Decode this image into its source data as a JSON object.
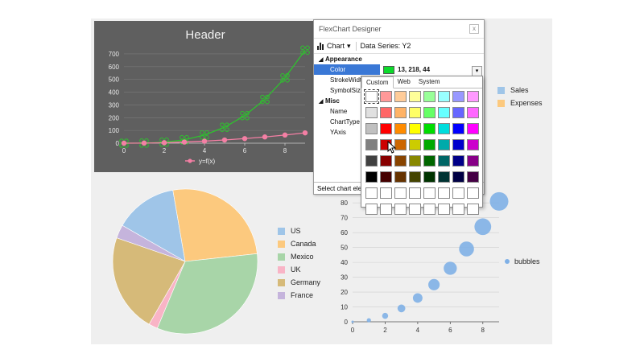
{
  "colors": {
    "bg": "#efefef",
    "line_panel": "#5f5f5f",
    "green": "#2ec22e",
    "pink": "#f47fa4",
    "selected": "#3a78d6"
  },
  "chart_data": [
    {
      "type": "line",
      "title": "Header",
      "x": [
        0,
        1,
        2,
        3,
        4,
        5,
        6,
        7,
        8,
        9
      ],
      "series": [
        {
          "name": "",
          "color": "#2ec22e",
          "values": [
            0,
            1,
            8,
            27,
            64,
            125,
            216,
            343,
            512,
            729
          ]
        },
        {
          "name": "y=f(x)",
          "color": "#f47fa4",
          "values": [
            0,
            1,
            4,
            9,
            16,
            25,
            36,
            49,
            64,
            81
          ]
        }
      ],
      "xticks": [
        "0",
        "2",
        "4",
        "6",
        "8"
      ],
      "yticks": [
        "0",
        "100",
        "200",
        "300",
        "400",
        "500",
        "600",
        "700"
      ],
      "xlim": [
        0,
        9
      ],
      "ylim": [
        0,
        750
      ],
      "legend": [
        "y=f(x)"
      ]
    },
    {
      "type": "pie",
      "slices": [
        {
          "name": "US",
          "value": 14,
          "color": "#9fc5e8"
        },
        {
          "name": "Canada",
          "value": 26,
          "color": "#fcc97e"
        },
        {
          "name": "Mexico",
          "value": 33,
          "color": "#a8d5a8"
        },
        {
          "name": "UK",
          "value": 2,
          "color": "#f9b4c6"
        },
        {
          "name": "Germany",
          "value": 22,
          "color": "#d6ba79"
        },
        {
          "name": "France",
          "value": 3,
          "color": "#c5b4dc"
        }
      ]
    },
    {
      "type": "scatter",
      "series": [
        {
          "name": "bubbles",
          "color": "#7fb0e6"
        }
      ],
      "x": [
        0,
        1,
        2,
        3,
        4,
        5,
        6,
        7,
        8,
        9
      ],
      "y": [
        0,
        1,
        4,
        9,
        16,
        25,
        36,
        49,
        64,
        81
      ],
      "xticks": [
        "0",
        "2",
        "4",
        "6",
        "8"
      ],
      "yticks": [
        "0",
        "10",
        "20",
        "30",
        "40",
        "50",
        "60",
        "70",
        "80"
      ],
      "xlim": [
        0,
        9
      ],
      "ylim": [
        0,
        85
      ]
    }
  ],
  "top_legend": {
    "items": [
      {
        "label": "Sales",
        "color": "#9fc5e8"
      },
      {
        "label": "Expenses",
        "color": "#fcc97e"
      }
    ]
  },
  "designer": {
    "title": "FlexChart Designer",
    "close_label": "x",
    "chart_menu": "Chart",
    "chart_menu_caret": "▾",
    "series_label": "Data Series: Y2",
    "categories": [
      {
        "name": "Appearance",
        "props": [
          {
            "name": "Color",
            "value": "13, 218, 44"
          },
          {
            "name": "StrokeWidth",
            "value": ""
          },
          {
            "name": "SymbolSize",
            "value": ""
          }
        ]
      },
      {
        "name": "Misc",
        "props": [
          {
            "name": "Name",
            "value": ""
          },
          {
            "name": "ChartType",
            "value": ""
          },
          {
            "name": "YAxis",
            "value": ""
          }
        ]
      }
    ],
    "dropdown_caret": "▾",
    "status": "Select chart element"
  },
  "picker": {
    "tabs": [
      "Custom",
      "Web",
      "System"
    ],
    "selected_row": 0,
    "selected_col": 0,
    "grid": [
      [
        "#ffffff",
        "#ff9999",
        "#ffcc99",
        "#ffff99",
        "#99ff99",
        "#99ffff",
        "#9999ff",
        "#ff99ff"
      ],
      [
        "#e0e0e0",
        "#ff6666",
        "#ffb366",
        "#ffff66",
        "#66ff66",
        "#66ffff",
        "#6666ff",
        "#ff66ff"
      ],
      [
        "#c0c0c0",
        "#ff0000",
        "#ff8c00",
        "#ffff00",
        "#00dd00",
        "#00dddd",
        "#0000ff",
        "#ff00ff"
      ],
      [
        "#808080",
        "#cc0000",
        "#cc6600",
        "#cccc00",
        "#00aa00",
        "#00aaaa",
        "#0000cc",
        "#cc00cc"
      ],
      [
        "#404040",
        "#880000",
        "#884400",
        "#888800",
        "#006600",
        "#006666",
        "#000088",
        "#880088"
      ],
      [
        "#000000",
        "#440000",
        "#663300",
        "#444400",
        "#003300",
        "#003333",
        "#000044",
        "#440044"
      ],
      [
        "#ffffff",
        "#ffffff",
        "#ffffff",
        "#ffffff",
        "#ffffff",
        "#ffffff",
        "#ffffff",
        "#ffffff"
      ],
      [
        "#ffffff",
        "#ffffff",
        "#ffffff",
        "#ffffff",
        "#ffffff",
        "#ffffff",
        "#ffffff",
        "#ffffff"
      ]
    ]
  }
}
